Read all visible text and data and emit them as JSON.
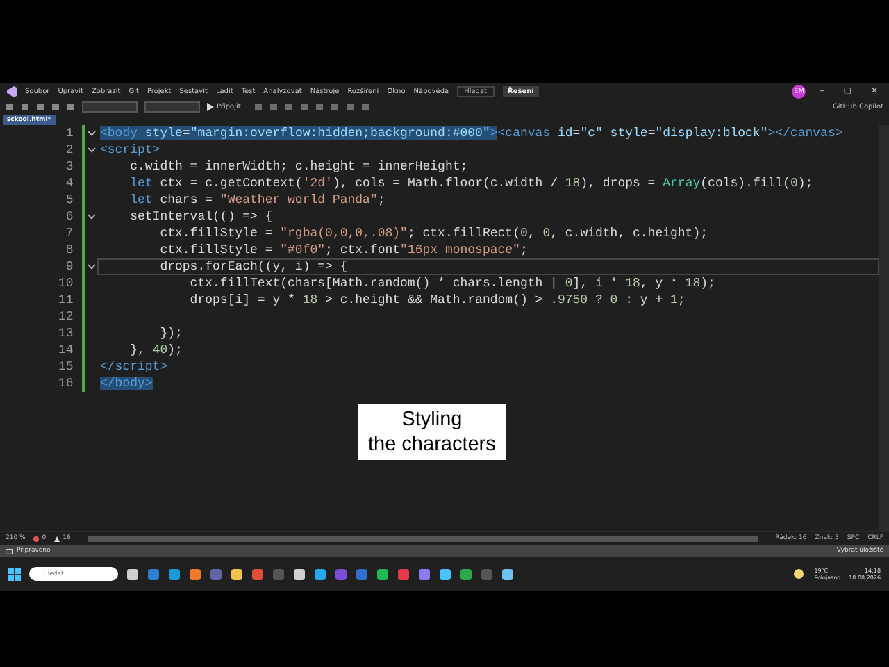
{
  "menu": {
    "items": [
      "Soubor",
      "Upravit",
      "Zobrazit",
      "Git",
      "Projekt",
      "Sestavit",
      "Ladit",
      "Test",
      "Analyzovat",
      "Nástroje",
      "Rozšíření",
      "Okno",
      "Nápověda"
    ],
    "search": "Hledat",
    "solution": "Řešení",
    "avatar": "EM",
    "window_controls": [
      "–",
      "▢",
      "✕"
    ]
  },
  "toolbar": {
    "run_label": "Připojit...",
    "copilot": "GitHub Copilot"
  },
  "tabs": [
    {
      "label": "sckool.html*",
      "selected": true
    }
  ],
  "editor": {
    "lines": [
      {
        "number": "1",
        "fold": true,
        "changed": true,
        "tokens": [
          {
            "text": "<body",
            "kind": "tag",
            "selected": true
          },
          {
            "text": " style",
            "kind": "attr",
            "selected": true
          },
          {
            "text": "=",
            "kind": "text",
            "selected": true
          },
          {
            "text": "\"margin:overflow:hidden;background:#000\"",
            "kind": "attr",
            "selected": true
          },
          {
            "text": ">",
            "kind": "tag",
            "selected": true
          },
          {
            "text": "<canvas",
            "kind": "tag"
          },
          {
            "text": " id",
            "kind": "attr"
          },
          {
            "text": "=",
            "kind": "text"
          },
          {
            "text": "\"c\"",
            "kind": "attr"
          },
          {
            "text": " style",
            "kind": "attr"
          },
          {
            "text": "=",
            "kind": "text"
          },
          {
            "text": "\"display:block\"",
            "kind": "attr"
          },
          {
            "text": "></canvas>",
            "kind": "tag"
          }
        ]
      },
      {
        "number": "2",
        "fold": true,
        "changed": true,
        "tokens": [
          {
            "text": "<script>",
            "kind": "tag"
          }
        ]
      },
      {
        "number": "3",
        "fold": false,
        "changed": true,
        "tokens": [
          {
            "text": "    c.width = innerWidth; c.height = innerHeight;",
            "kind": "text"
          }
        ]
      },
      {
        "number": "4",
        "fold": false,
        "changed": true,
        "tokens": [
          {
            "text": "    let",
            "kind": "kw"
          },
          {
            "text": " ctx = c.getContext(",
            "kind": "text"
          },
          {
            "text": "'2d'",
            "kind": "str"
          },
          {
            "text": "), cols = Math.floor(c.width / ",
            "kind": "text"
          },
          {
            "text": "18",
            "kind": "num"
          },
          {
            "text": "), drops = ",
            "kind": "text"
          },
          {
            "text": "Array",
            "kind": "cls"
          },
          {
            "text": "(cols).fill(",
            "kind": "text"
          },
          {
            "text": "0",
            "kind": "num"
          },
          {
            "text": ");",
            "kind": "text"
          }
        ]
      },
      {
        "number": "5",
        "fold": false,
        "changed": true,
        "tokens": [
          {
            "text": "    let",
            "kind": "kw"
          },
          {
            "text": " chars = ",
            "kind": "text"
          },
          {
            "text": "\"Weather world Panda\"",
            "kind": "str"
          },
          {
            "text": ";",
            "kind": "text"
          }
        ]
      },
      {
        "number": "6",
        "fold": true,
        "changed": true,
        "tokens": [
          {
            "text": "    setInterval(() => {",
            "kind": "text"
          }
        ]
      },
      {
        "number": "7",
        "fold": false,
        "changed": true,
        "tokens": [
          {
            "text": "        ctx.fillStyle = ",
            "kind": "text"
          },
          {
            "text": "\"rgba(0,0,0,.08)\"",
            "kind": "str"
          },
          {
            "text": "; ctx.fillRect(",
            "kind": "text"
          },
          {
            "text": "0",
            "kind": "num"
          },
          {
            "text": ", ",
            "kind": "text"
          },
          {
            "text": "0",
            "kind": "num"
          },
          {
            "text": ", c.width, c.height);",
            "kind": "text"
          }
        ]
      },
      {
        "number": "8",
        "fold": false,
        "changed": true,
        "tokens": [
          {
            "text": "        ctx.fillStyle = ",
            "kind": "text"
          },
          {
            "text": "\"#0f0\"",
            "kind": "str"
          },
          {
            "text": "; ctx.font",
            "kind": "text"
          },
          {
            "text": "\"16px monospace\"",
            "kind": "str"
          },
          {
            "text": ";",
            "kind": "text"
          }
        ]
      },
      {
        "number": "9",
        "fold": true,
        "changed": true,
        "current": true,
        "tokens": [
          {
            "text": "        drops.forEach((y, i) => {",
            "kind": "text"
          }
        ]
      },
      {
        "number": "10",
        "fold": false,
        "changed": true,
        "tokens": [
          {
            "text": "            ctx.fillText(chars[Math.random() * chars.length | ",
            "kind": "text"
          },
          {
            "text": "0",
            "kind": "num"
          },
          {
            "text": "], i * ",
            "kind": "text"
          },
          {
            "text": "18",
            "kind": "num"
          },
          {
            "text": ", y * ",
            "kind": "text"
          },
          {
            "text": "18",
            "kind": "num"
          },
          {
            "text": ");",
            "kind": "text"
          }
        ]
      },
      {
        "number": "11",
        "fold": false,
        "changed": true,
        "tokens": [
          {
            "text": "            drops[i] = y * ",
            "kind": "text"
          },
          {
            "text": "18",
            "kind": "num"
          },
          {
            "text": " > c.height && Math.random() > ",
            "kind": "text"
          },
          {
            "text": ".9750",
            "kind": "num"
          },
          {
            "text": " ? ",
            "kind": "text"
          },
          {
            "text": "0",
            "kind": "num"
          },
          {
            "text": " : y + ",
            "kind": "text"
          },
          {
            "text": "1",
            "kind": "num"
          },
          {
            "text": ";",
            "kind": "text"
          }
        ]
      },
      {
        "number": "12",
        "fold": false,
        "changed": true
      },
      {
        "number": "13",
        "fold": false,
        "changed": true,
        "tokens": [
          {
            "text": "        });",
            "kind": "text"
          }
        ]
      },
      {
        "number": "14",
        "fold": false,
        "changed": true,
        "tokens": [
          {
            "text": "    }, ",
            "kind": "text"
          },
          {
            "text": "40",
            "kind": "num"
          },
          {
            "text": ");",
            "kind": "text"
          }
        ]
      },
      {
        "number": "15",
        "fold": false,
        "changed": true,
        "tokens": [
          {
            "text": "</script>",
            "kind": "tag"
          }
        ]
      },
      {
        "number": "16",
        "fold": false,
        "changed": true,
        "tokens": [
          {
            "text": "</body>",
            "kind": "tag",
            "selected": true
          }
        ]
      }
    ]
  },
  "caption": [
    "Styling",
    "the characters"
  ],
  "status_bar": {
    "zoom": "210 %",
    "errors": "0",
    "warnings": "16",
    "line": "Řádek: 16",
    "column": "Znak: 5",
    "spacing": "SPC",
    "line_endings": "CRLF"
  },
  "output_bar": {
    "status": "Připraveno",
    "repository": "Vybrat úložiště"
  },
  "taskbar": {
    "search_placeholder": "Hledat",
    "temperature": "19°C",
    "weather": "Polojasno",
    "time": "14:18",
    "date": "18.08.2026"
  }
}
